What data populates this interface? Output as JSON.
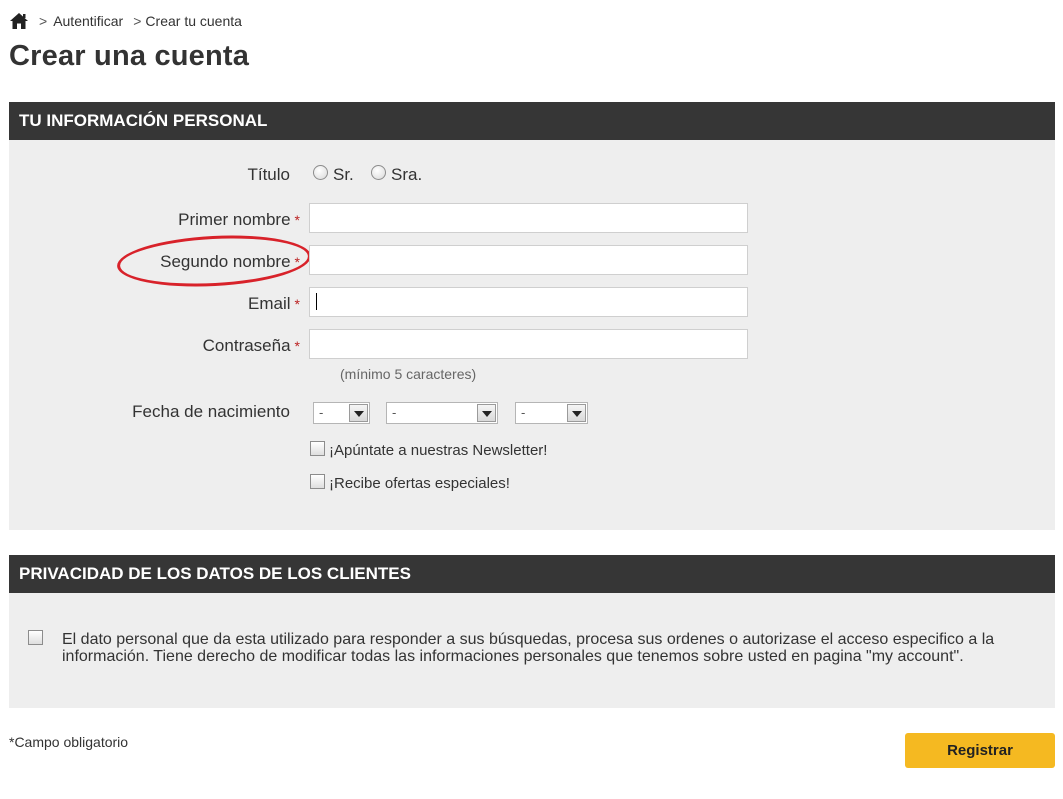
{
  "breadcrumb": {
    "home_icon": "home-icon",
    "items": [
      {
        "sep": ">",
        "label": "Autentificar"
      },
      {
        "sep": ">",
        "label": "Crear tu cuenta"
      }
    ]
  },
  "page_title": "Crear una cuenta",
  "personal": {
    "header": "TU INFORMACIÓN PERSONAL",
    "title_label": "Título",
    "title_options": [
      "Sr.",
      "Sra."
    ],
    "required_mark": "*",
    "first_name_label": "Primer nombre",
    "first_name_value": "",
    "last_name_label": "Segundo nombre",
    "last_name_value": "",
    "email_label": "Email",
    "email_value": "",
    "password_label": "Contraseña",
    "password_value": "",
    "password_hint": "(mínimo 5 caracteres)",
    "birthdate_label": "Fecha de nacimiento",
    "birthdate_day": "-",
    "birthdate_month": "-",
    "birthdate_year": "-",
    "newsletter_label": "¡Apúntate a nuestras Newsletter!",
    "offers_label": "¡Recibe ofertas especiales!"
  },
  "privacy": {
    "header": "PRIVACIDAD DE LOS DATOS DE LOS CLIENTES",
    "text": "El dato personal que da esta utilizado para responder a sus búsquedas, procesa sus ordenes o autorizase el acceso especifico a la información. Tiene derecho de modificar todas las informaciones personales que tenemos sobre usted en pagina \"my account\"."
  },
  "footer": {
    "required_note": "*Campo obligatorio",
    "submit_label": "Registrar"
  },
  "colors": {
    "header_bg": "#363636",
    "panel_bg": "#eeeeee",
    "button_bg": "#f5b921",
    "annotation": "#d8222a"
  }
}
